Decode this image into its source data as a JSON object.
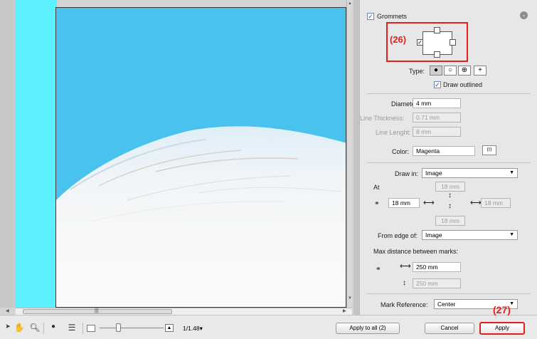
{
  "panel": {
    "section_title": "Grommets",
    "annotation_26": "(26)",
    "type_label": "Type:",
    "type_options": [
      "●",
      "○",
      "⊕",
      "+"
    ],
    "draw_outlined_label": "Draw outlined",
    "diameter_label": "Diameter:",
    "diameter_value": "4 mm",
    "line_thickness_label": "Line Thickness:",
    "line_thickness_value": "0.71 mm",
    "line_length_label": "Line Lenght:",
    "line_length_value": "8 mm",
    "color_label": "Color:",
    "color_value": "Magenta",
    "color_picker_glyph": "⟨I⟩",
    "draw_in_label": "Draw in:",
    "draw_in_value": "Image",
    "at_label": "At",
    "top_value": "18 mm",
    "left_value": "18 mm",
    "right_value": "18 mm",
    "bottom_value": "18 mm",
    "from_edge_label": "From edge of:",
    "from_edge_value": "Image",
    "max_distance_label": "Max distance between marks:",
    "horizontal_distance_value": "250 mm",
    "vertical_distance_value": "250 mm",
    "mark_reference_label": "Mark Reference:",
    "mark_reference_value": "Center"
  },
  "toolbar": {
    "zoom_value": "1/1.48",
    "apply_all_label": "Apply to all (2)",
    "cancel_label": "Cancel",
    "apply_label": "Apply",
    "annotation_27": "(27)"
  },
  "colors": {
    "annotation_red": "#e21e1e",
    "sky_blue": "#49c3ee",
    "cyan_strip": "#5bf0fb"
  }
}
